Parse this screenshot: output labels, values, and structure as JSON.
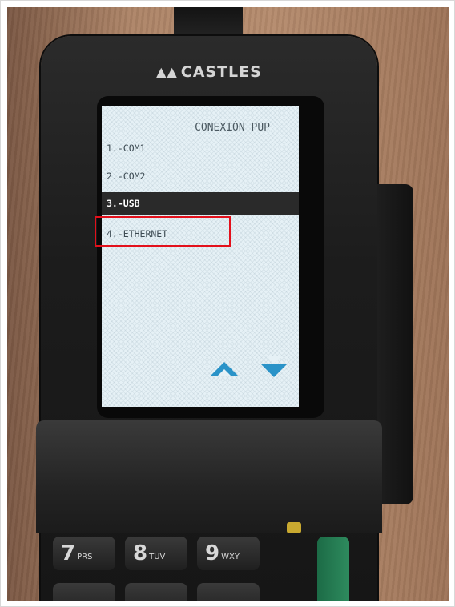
{
  "device": {
    "brand": "CASTLES",
    "brand_icon": "castles-logo-icon"
  },
  "screen": {
    "title": "CONEXIÓN PUP",
    "menu": [
      {
        "label": "1.-COM1",
        "selected": false
      },
      {
        "label": "2.-COM2",
        "selected": false
      },
      {
        "label": "3.-USB",
        "selected": true
      },
      {
        "label": "4.-ETHERNET",
        "selected": false
      }
    ],
    "nav": {
      "up_icon": "chevron-up-icon",
      "down_icon": "chevron-down-icon"
    },
    "colors": {
      "accent": "#2a93c8",
      "selection_bg": "#2a2a2a",
      "annotation": "#e3101b"
    }
  },
  "keypad": {
    "keys": [
      {
        "digit": "7",
        "letters": "PRS"
      },
      {
        "digit": "8",
        "letters": "TUV"
      },
      {
        "digit": "9",
        "letters": "WXY"
      }
    ]
  }
}
